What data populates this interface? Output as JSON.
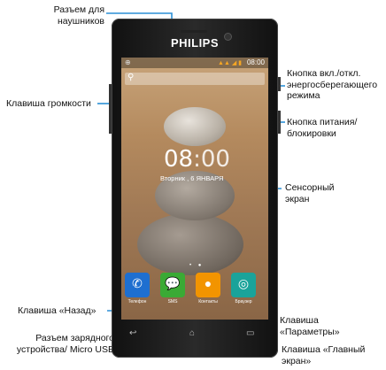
{
  "callouts": {
    "headphone": "Разъем для наушников",
    "volume": "Клавиша громкости",
    "power_save": "Кнопка вкл./откл. энергосберегающего режима",
    "power": "Кнопка питания/ блокировки",
    "touchscreen": "Сенсорный экран",
    "back": "Клавиша «Назад»",
    "charger": "Разъем зарядного устройства/ Micro USB",
    "options": "Клавиша «Параметры»",
    "home": "Клавиша «Главный экран»"
  },
  "phone": {
    "brand": "PHILIPS",
    "status_time": "08:00",
    "clock_hours": "08",
    "clock_minutes": ":00",
    "date": "Вторник , 6 ЯНВАРЯ",
    "apps": [
      {
        "label": "Телефон",
        "color": "#1e6fd0",
        "icon": "phone-icon"
      },
      {
        "label": "SMS",
        "color": "#3aaa35",
        "icon": "chat-icon"
      },
      {
        "label": "Контакты",
        "color": "#f29400",
        "icon": "contacts-icon"
      },
      {
        "label": "Браузер",
        "color": "#1aa39a",
        "icon": "globe-icon"
      }
    ]
  },
  "colors": {
    "leader_line": "#2b8fd6"
  }
}
